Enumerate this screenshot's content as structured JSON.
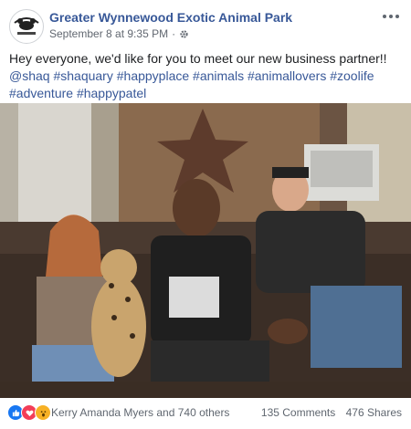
{
  "page": {
    "name": "Greater Wynnewood Exotic Animal Park",
    "date": "September 8 at 9:35 PM",
    "separator": "·",
    "logo_text": "Greater Wynnewood Exotic Animal Park"
  },
  "post": {
    "line1": "Hey everyone, we'd like for you to meet our new business partner!!",
    "mention": "@shaq",
    "hashtags": [
      "#shaquary",
      "#happyplace",
      "#animals",
      "#animallovers",
      "#zoolife",
      "#adventure",
      "#happypatel"
    ]
  },
  "reactions": {
    "types": [
      "like-icon",
      "love-icon",
      "wow-icon"
    ],
    "colors": {
      "like": "#1877f2",
      "love": "#f33e58",
      "wow": "#f7b125"
    },
    "names": "Kerry Amanda Myers and 740 others"
  },
  "stats": {
    "comments": "135 Comments",
    "shares": "476 Shares"
  },
  "colors": {
    "link": "#385898",
    "meta": "#616770"
  }
}
